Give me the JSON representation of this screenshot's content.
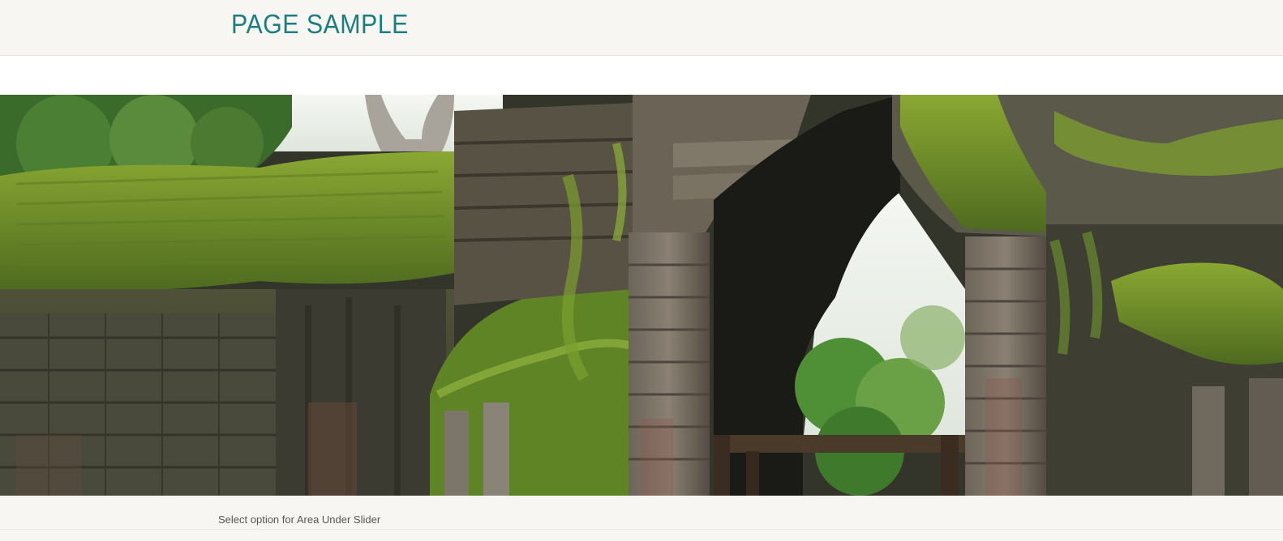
{
  "header": {
    "site_title": "PAGE SAMPLE"
  },
  "slider": {
    "image_alt": "Moss-covered ancient temple ruins with stone doorway",
    "colors": {
      "sky": "#f4f6f2",
      "moss": "#7a9a2a",
      "stone": "#5b5a50",
      "dark_stone": "#2c2a24",
      "foliage": "#3f7a2c"
    }
  },
  "under_slider": {
    "text": "Select option for Area Under Slider"
  },
  "theme": {
    "title_color": "#1b7f7f",
    "header_bg": "#f7f6f3"
  }
}
